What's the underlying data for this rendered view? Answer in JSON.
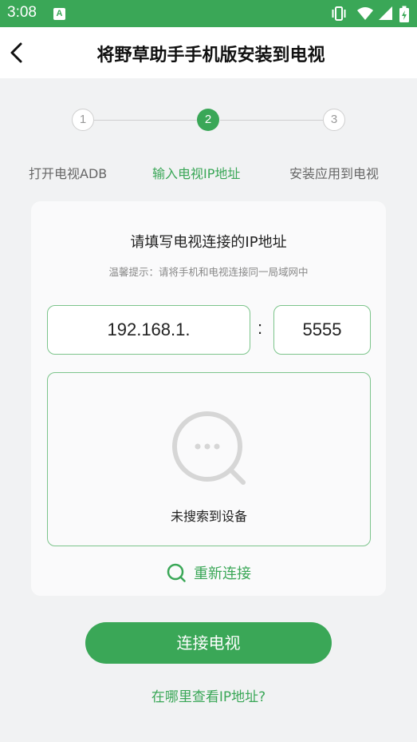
{
  "status_bar": {
    "time": "3:08",
    "notification_letter": "A",
    "icons": [
      "vibrate-icon",
      "wifi-icon",
      "signal-icon",
      "battery-icon"
    ]
  },
  "app_bar": {
    "back_icon": "chevron-left-icon",
    "title": "将野草助手手机版安装到电视"
  },
  "stepper": {
    "steps": [
      {
        "number": "1",
        "label": "打开电视ADB",
        "state": "inactive"
      },
      {
        "number": "2",
        "label": "输入电视IP地址",
        "state": "active"
      },
      {
        "number": "3",
        "label": "安装应用到电视",
        "state": "inactive"
      }
    ]
  },
  "card": {
    "heading": "请填写电视连接的IP地址",
    "tip": "温馨提示：请将手机和电视连接同一局域网中",
    "ip_value": "192.168.1.",
    "separator": ":",
    "port_value": "5555",
    "empty_icon": "search-chat-icon",
    "empty_text": "未搜索到设备",
    "reconnect_icon": "search-icon",
    "reconnect_label": "重新连接"
  },
  "connect_button": "连接电视",
  "help_link": "在哪里查看IP地址?",
  "colors": {
    "accent": "#3aa757",
    "border": "#7cc48b",
    "background": "#f1f2f3"
  }
}
